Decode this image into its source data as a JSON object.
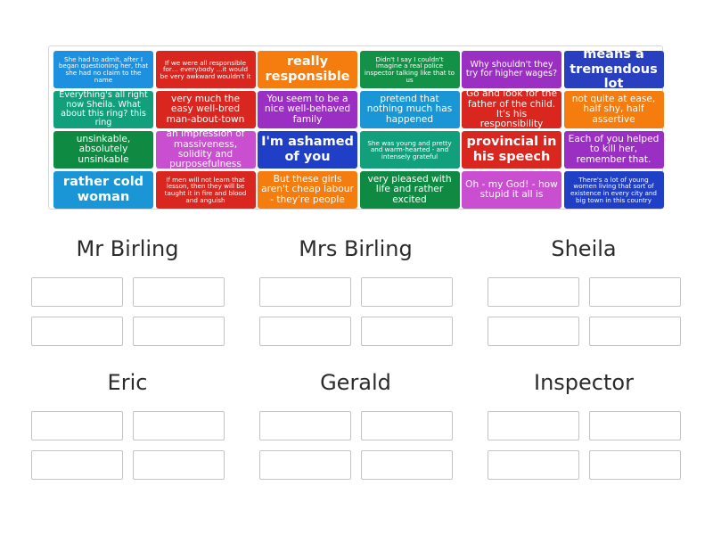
{
  "tiles": [
    {
      "text": "She had to admit, after I began questioning her, that she had no claim to the name",
      "color": "#1e90e0"
    },
    {
      "text": "If we were all responsible for… everybody ...it would be very awkward wouldn't it",
      "color": "#d9261f"
    },
    {
      "text": "really responsible",
      "color": "#f57c0e"
    },
    {
      "text": "Didn't I say I couldn't imagine a real police inspector talking like that to us",
      "color": "#139146"
    },
    {
      "text": "Why shouldn't they try for higher wages?",
      "color": "#9b2fc4"
    },
    {
      "text": "means a tremendous lot",
      "color": "#283fbf"
    },
    {
      "text": "Everything's all right now Sheila. What about this ring? this ring",
      "color": "#12a07c"
    },
    {
      "text": "very much the easy well-bred man-about-town",
      "color": "#d9261f"
    },
    {
      "text": "You seem to be a nice well-behaved family",
      "color": "#9b2fc4"
    },
    {
      "text": "pretend that nothing much has happened",
      "color": "#1a96d6"
    },
    {
      "text": "Go and look for the father of the child. It's his responsibility",
      "color": "#d9261f"
    },
    {
      "text": "not quite at ease, half shy, half assertive",
      "color": "#f57c0e"
    },
    {
      "text": "unsinkable, absolutely unsinkable",
      "color": "#0f8a43"
    },
    {
      "text": "an impression of massiveness, solidity and purposefulness",
      "color": "#c94fd0"
    },
    {
      "text": "I'm ashamed of you",
      "color": "#1f3fc6"
    },
    {
      "text": "She was young and pretty and warm-hearted - and intensely grateful",
      "color": "#12a07c"
    },
    {
      "text": "provincial in his speech",
      "color": "#d9261f"
    },
    {
      "text": "Each of you helped to kill her, remember that.",
      "color": "#9b2fc4"
    },
    {
      "text": "rather cold woman",
      "color": "#1a96d6"
    },
    {
      "text": "If men will not learn that lesson, then they will be taught it in fire and blood and anguish",
      "color": "#d9261f"
    },
    {
      "text": "But these girls aren't cheap labour - they're people",
      "color": "#f57c0e"
    },
    {
      "text": "very pleased with life and rather excited",
      "color": "#0f8a43"
    },
    {
      "text": "Oh - my God! - how stupid it all is",
      "color": "#c94fd0"
    },
    {
      "text": "There's a lot of young women living that sort of existence in every city and big town in this country",
      "color": "#1f3fc6"
    }
  ],
  "groups": [
    {
      "title": "Mr Birling"
    },
    {
      "title": "Mrs Birling"
    },
    {
      "title": "Sheila"
    },
    {
      "title": "Eric"
    },
    {
      "title": "Gerald"
    },
    {
      "title": "Inspector"
    }
  ]
}
